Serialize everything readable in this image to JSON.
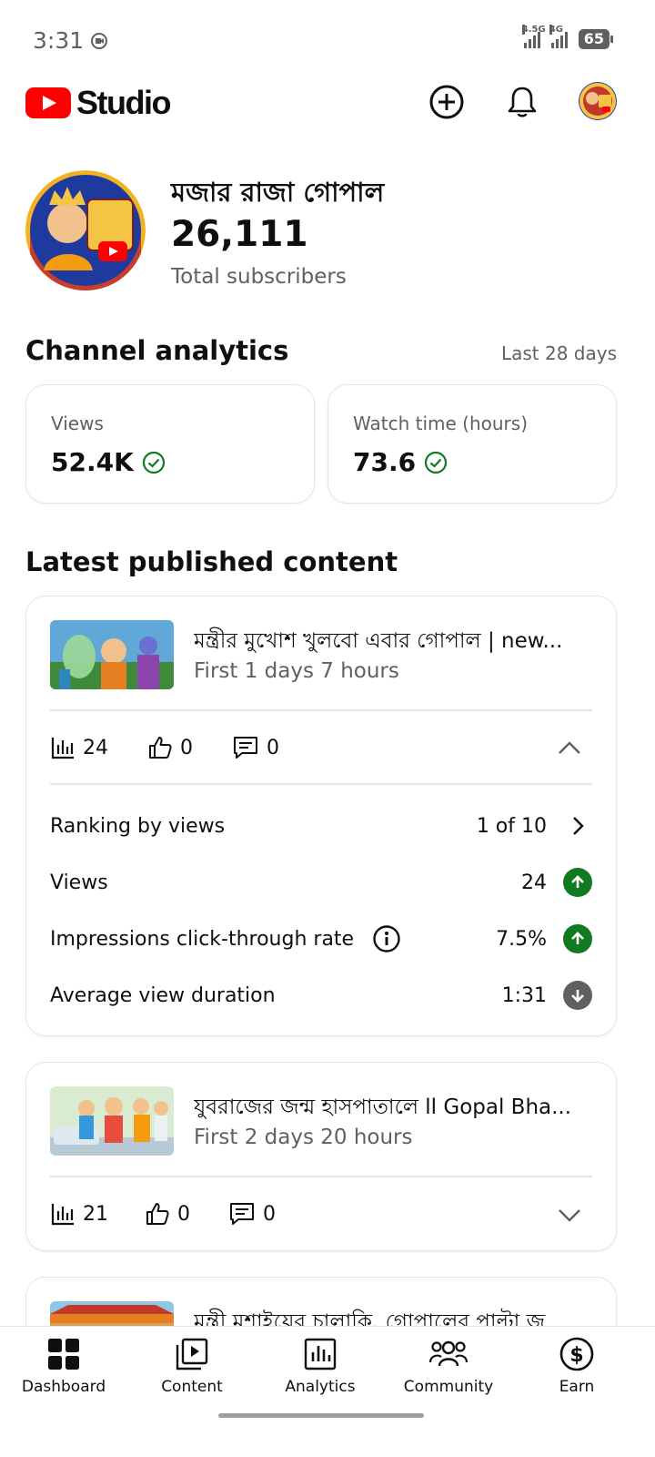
{
  "status_bar": {
    "time": "3:31",
    "net1": "4.5G",
    "net2": "4G",
    "battery": "65"
  },
  "app": {
    "brand": "Studio"
  },
  "channel": {
    "name": "মজার রাজা গোপাল",
    "subscribers": "26,111",
    "subscribers_label": "Total subscribers"
  },
  "analytics": {
    "title": "Channel analytics",
    "range": "Last 28 days",
    "views_label": "Views",
    "views_value": "52.4K",
    "watch_label": "Watch time (hours)",
    "watch_value": "73.6"
  },
  "latest": {
    "title": "Latest published content",
    "items": [
      {
        "title": "মন্ত্রীর মুখোশ খুলবো এবার গোপাল | new...",
        "age": "First 1 days 7 hours",
        "views": "24",
        "likes": "0",
        "comments": "0",
        "expanded": true,
        "details": {
          "ranking_label": "Ranking by views",
          "ranking_value": "1 of 10",
          "views_label": "Views",
          "views_value": "24",
          "views_trend": "up",
          "ctr_label": "Impressions click-through rate",
          "ctr_value": "7.5%",
          "ctr_trend": "up",
          "avd_label": "Average view duration",
          "avd_value": "1:31",
          "avd_trend": "down"
        }
      },
      {
        "title": "যুবরাজের জন্ম হাসপাতালে ll Gopal Bha...",
        "age": "First 2 days 20 hours",
        "views": "21",
        "likes": "0",
        "comments": "0",
        "expanded": false
      },
      {
        "title": "মন্ত্রী মশাইয়ের চালাকি, গোপালের পাল্টা জ...",
        "age": ""
      }
    ]
  },
  "nav": [
    {
      "label": "Dashboard",
      "icon": "dashboard-icon",
      "active": true
    },
    {
      "label": "Content",
      "icon": "content-icon"
    },
    {
      "label": "Analytics",
      "icon": "analytics-icon"
    },
    {
      "label": "Community",
      "icon": "community-icon"
    },
    {
      "label": "Earn",
      "icon": "earn-icon"
    }
  ],
  "colors": {
    "accent_red": "#ff0000",
    "trend_up": "#0f7a1f",
    "trend_down": "#606060",
    "check_green": "#0f7a1f"
  }
}
